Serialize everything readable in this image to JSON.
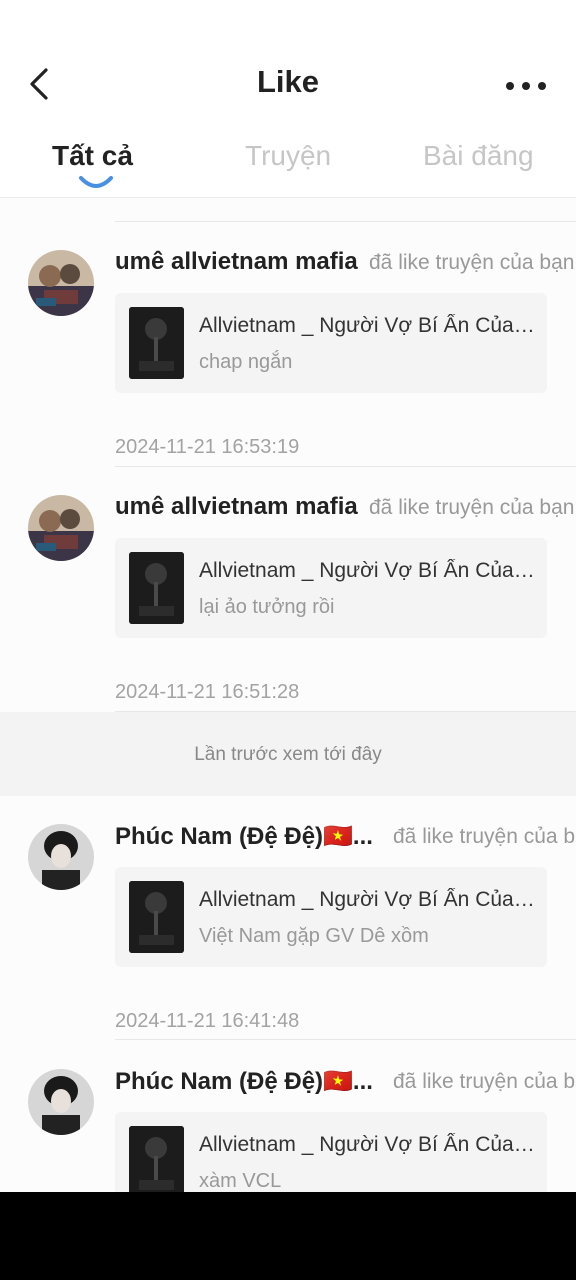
{
  "header": {
    "title": "Like",
    "back_icon": "chevron-left-icon",
    "more_icon": "more-horizontal-icon"
  },
  "tabs": [
    {
      "label": "Tất cả",
      "active": true
    },
    {
      "label": "Truyện",
      "active": false
    },
    {
      "label": "Bài đăng",
      "active": false
    }
  ],
  "divider": {
    "label": "Lần trước xem tới đây"
  },
  "notifications": [
    {
      "username": "umê allvietnam mafia",
      "action": "đã like truyện của bạn",
      "story_title": "Allvietnam _ Người Vợ Bí Ẩn Của Tổng Tài",
      "chapter": "chap ngắn",
      "timestamp": "2024-11-21 16:53:19"
    },
    {
      "username": "umê allvietnam mafia",
      "action": "đã like truyện của bạn",
      "story_title": "Allvietnam _ Người Vợ Bí Ẩn Của Tổng Tài",
      "chapter": "lại ảo tưởng rồi",
      "timestamp": "2024-11-21 16:51:28"
    },
    {
      "username": "Phúc Nam (Đệ Đệ)🇻🇳...",
      "action": "đã like truyện của bạn",
      "story_title": "Allvietnam _ Người Vợ Bí Ẩn Của Tổng Tài",
      "chapter": "Việt Nam gặp GV Dê xồm",
      "timestamp": "2024-11-21 16:41:48"
    },
    {
      "username": "Phúc Nam (Đệ Đệ)🇻🇳...",
      "action": "đã like truyện của bạn",
      "story_title": "Allvietnam _ Người Vợ Bí Ẩn Của Tổng Tài",
      "chapter": "xàm VCL",
      "timestamp": ""
    }
  ],
  "colors": {
    "accent": "#4a90e2",
    "inactive_tab": "#c6c6c6",
    "card_bg": "#f4f4f4"
  }
}
